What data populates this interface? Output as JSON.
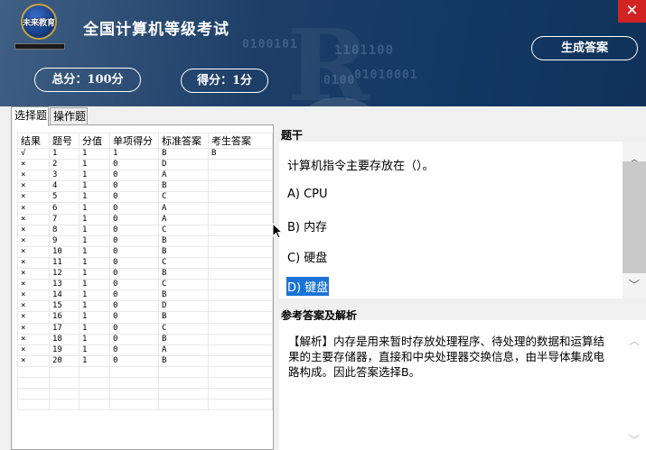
{
  "header": {
    "logo_text": "未来教育",
    "title": "全国计算机等级考试",
    "total_score": "总分：100分",
    "score": "得分：1分",
    "generate_button": "生成答案",
    "close_label": "✕",
    "bg_binary": [
      "0100101",
      "1101100",
      "01010001",
      "0100"
    ]
  },
  "tabs": [
    {
      "label": "选择题",
      "active": true
    },
    {
      "label": "操作题",
      "active": false
    }
  ],
  "table": {
    "headers": [
      "结果",
      "题号",
      "分值",
      "单项得分",
      "标准答案",
      "考生答案"
    ],
    "rows": [
      {
        "result": "√",
        "correct": true,
        "no": "1",
        "value": "1",
        "got": "1",
        "std": "B",
        "ans": "B"
      },
      {
        "result": "×",
        "correct": false,
        "no": "2",
        "value": "1",
        "got": "0",
        "std": "D",
        "ans": ""
      },
      {
        "result": "×",
        "correct": false,
        "no": "3",
        "value": "1",
        "got": "0",
        "std": "A",
        "ans": ""
      },
      {
        "result": "×",
        "correct": false,
        "no": "4",
        "value": "1",
        "got": "0",
        "std": "B",
        "ans": ""
      },
      {
        "result": "×",
        "correct": false,
        "no": "5",
        "value": "1",
        "got": "0",
        "std": "C",
        "ans": ""
      },
      {
        "result": "×",
        "correct": false,
        "no": "6",
        "value": "1",
        "got": "0",
        "std": "A",
        "ans": ""
      },
      {
        "result": "×",
        "correct": false,
        "no": "7",
        "value": "1",
        "got": "0",
        "std": "A",
        "ans": ""
      },
      {
        "result": "×",
        "correct": false,
        "no": "8",
        "value": "1",
        "got": "0",
        "std": "C",
        "ans": ""
      },
      {
        "result": "×",
        "correct": false,
        "no": "9",
        "value": "1",
        "got": "0",
        "std": "B",
        "ans": ""
      },
      {
        "result": "×",
        "correct": false,
        "no": "10",
        "value": "1",
        "got": "0",
        "std": "B",
        "ans": ""
      },
      {
        "result": "×",
        "correct": false,
        "no": "11",
        "value": "1",
        "got": "0",
        "std": "C",
        "ans": ""
      },
      {
        "result": "×",
        "correct": false,
        "no": "12",
        "value": "1",
        "got": "0",
        "std": "B",
        "ans": ""
      },
      {
        "result": "×",
        "correct": false,
        "no": "13",
        "value": "1",
        "got": "0",
        "std": "C",
        "ans": ""
      },
      {
        "result": "×",
        "correct": false,
        "no": "14",
        "value": "1",
        "got": "0",
        "std": "B",
        "ans": ""
      },
      {
        "result": "×",
        "correct": false,
        "no": "15",
        "value": "1",
        "got": "0",
        "std": "D",
        "ans": ""
      },
      {
        "result": "×",
        "correct": false,
        "no": "16",
        "value": "1",
        "got": "0",
        "std": "B",
        "ans": ""
      },
      {
        "result": "×",
        "correct": false,
        "no": "17",
        "value": "1",
        "got": "0",
        "std": "C",
        "ans": ""
      },
      {
        "result": "×",
        "correct": false,
        "no": "18",
        "value": "1",
        "got": "0",
        "std": "B",
        "ans": ""
      },
      {
        "result": "×",
        "correct": false,
        "no": "19",
        "value": "1",
        "got": "0",
        "std": "A",
        "ans": ""
      },
      {
        "result": "×",
        "correct": false,
        "no": "20",
        "value": "1",
        "got": "0",
        "std": "B",
        "ans": ""
      }
    ]
  },
  "question": {
    "section_title": "题干",
    "stem": "计算机指令主要存放在（）。",
    "options": [
      {
        "text": "A) CPU",
        "selected": false
      },
      {
        "text": "B) 内存",
        "selected": false
      },
      {
        "text": "C) 硬盘",
        "selected": false
      },
      {
        "text": "D) 键盘",
        "selected": true
      }
    ]
  },
  "analysis": {
    "section_title": "参考答案及解析",
    "text": "【解析】内存是用来暂时存放处理程序、待处理的数据和运算结果的主要存储器，直接和中央处理器交换信息，由半导体集成电路构成。因此答案选择B。"
  },
  "scrollbars": {
    "up_icon": "chevron-up-icon",
    "down_icon": "chevron-down-icon"
  },
  "colors": {
    "header_dark": "#123863",
    "correct_mark": "#3b59b8",
    "wrong_mark": "#e4392e",
    "selection": "#1a73d6",
    "close_red": "#d32222"
  }
}
